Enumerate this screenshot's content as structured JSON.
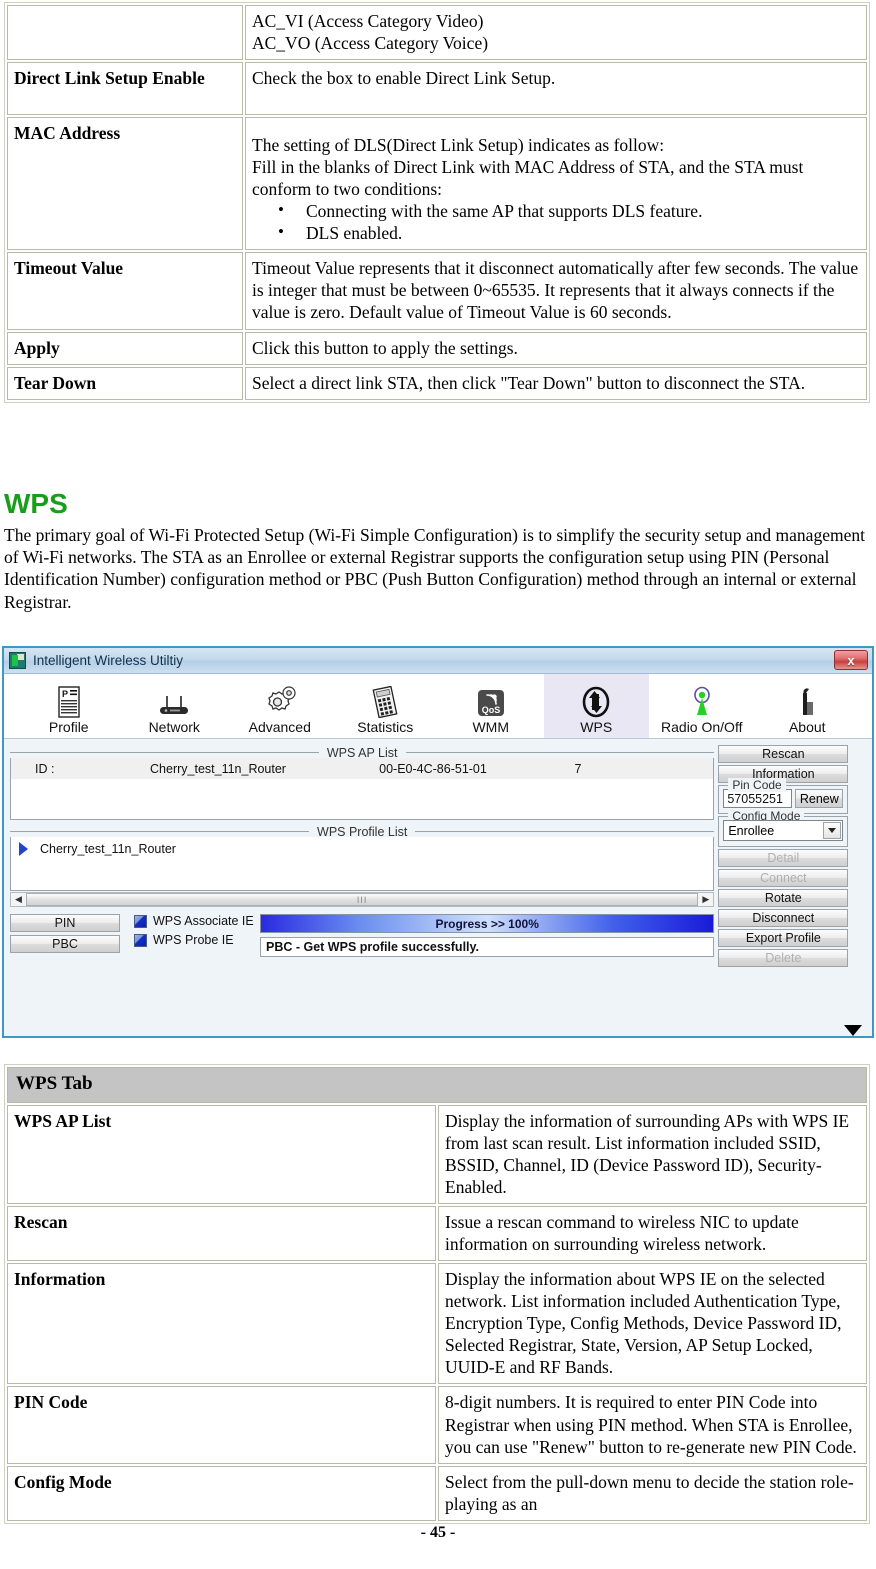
{
  "dls_table": {
    "rows": [
      {
        "key": "",
        "lines": [
          "AC_VI (Access Category Video)",
          "AC_VO (Access Category Voice)"
        ]
      },
      {
        "key": "Direct Link Setup Enable",
        "lines": [
          "Check the box to enable Direct Link Setup."
        ]
      },
      {
        "key": "MAC Address",
        "lines": [
          "The setting of DLS(Direct Link Setup) indicates as follow:",
          "Fill in the blanks of Direct Link with MAC Address of STA, and the STA must conform to two conditions:"
        ],
        "bullets": [
          "Connecting with the same AP that supports DLS feature.",
          "DLS enabled."
        ]
      },
      {
        "key": "Timeout Value",
        "lines": [
          "Timeout Value represents that it disconnect automatically after few seconds. The value is integer that must be between 0~65535. It represents that it always connects if the value is zero. Default value of Timeout Value is 60 seconds."
        ]
      },
      {
        "key": "Apply",
        "lines": [
          "Click this button to apply the settings."
        ]
      },
      {
        "key": "Tear Down",
        "lines": [
          "Select a direct link STA, then click \"Tear Down\" button to disconnect the STA."
        ]
      }
    ]
  },
  "wps_section": {
    "heading": "WPS",
    "heading_color": "#1a9e1a",
    "paragraph": "The primary goal of Wi-Fi Protected Setup (Wi-Fi Simple Configuration) is to simplify the security setup and management of Wi-Fi networks. The STA as an Enrollee or external Registrar supports the configuration setup using PIN (Personal Identification Number) configuration method or PBC (Push Button Configuration) method through an internal or external Registrar."
  },
  "app": {
    "title": "Intelligent Wireless Utiltiy",
    "close_label": "x",
    "toolbar": [
      {
        "label": "Profile",
        "icon": "profile-icon",
        "active": false
      },
      {
        "label": "Network",
        "icon": "router-icon",
        "active": false
      },
      {
        "label": "Advanced",
        "icon": "gears-icon",
        "active": false
      },
      {
        "label": "Statistics",
        "icon": "calculator-icon",
        "active": false
      },
      {
        "label": "WMM",
        "icon": "qos-icon",
        "active": false
      },
      {
        "label": "WPS",
        "icon": "wps-arrows-icon",
        "active": true
      },
      {
        "label": "Radio On/Off",
        "icon": "radio-tower-icon",
        "active": false
      },
      {
        "label": "About",
        "icon": "about-icon",
        "active": false
      }
    ],
    "ap_list": {
      "group_title": "WPS AP List",
      "row": {
        "id_label": "ID :",
        "ssid": "Cherry_test_11n_Router",
        "bssid": "00-E0-4C-86-51-01",
        "channel": "7"
      }
    },
    "profile_list": {
      "group_title": "WPS Profile List",
      "row": {
        "name": "Cherry_test_11n_Router"
      }
    },
    "scrollbar": {
      "left_arrow": "◀",
      "right_arrow": "▶",
      "grip": "III"
    },
    "method_buttons": [
      {
        "label": "PIN"
      },
      {
        "label": "PBC"
      }
    ],
    "checkboxes": [
      {
        "label": "WPS Associate IE",
        "checked": true
      },
      {
        "label": "WPS Probe IE",
        "checked": true
      }
    ],
    "progress": {
      "text": "Progress >> 100%",
      "percent": 100
    },
    "status": "PBC - Get WPS profile successfully.",
    "side_panel": {
      "rescan": "Rescan",
      "information": "Information",
      "pin_code_legend": "Pin Code",
      "pin_code_value": "57055251",
      "renew": "Renew",
      "config_mode_legend": "Config Mode",
      "config_mode_value": "Enrollee",
      "detail": "Detail",
      "connect": "Connect",
      "rotate": "Rotate",
      "disconnect": "Disconnect",
      "export_profile": "Export Profile",
      "delete": "Delete"
    }
  },
  "wps_table": {
    "header": "WPS Tab",
    "rows": [
      {
        "key": "WPS AP List",
        "text": "Display the information of surrounding APs with WPS IE from last scan result. List information included SSID, BSSID, Channel, ID (Device Password ID), Security-Enabled."
      },
      {
        "key": "Rescan",
        "text": "Issue a rescan command to wireless NIC to update information on surrounding wireless network."
      },
      {
        "key": "Information",
        "text": "Display the information about WPS IE on the selected network. List information included Authentication Type, Encryption Type, Config Methods, Device Password ID, Selected Registrar, State, Version, AP Setup Locked, UUID-E and RF Bands."
      },
      {
        "key": "PIN Code",
        "text": "8-digit numbers. It is required to enter PIN Code into Registrar when using PIN method. When STA is Enrollee, you can use \"Renew\" button to re-generate new PIN Code."
      },
      {
        "key": "Config Mode",
        "text": "Select from the pull-down menu to decide the station role-playing as an"
      }
    ]
  },
  "footer": "- 45 -"
}
